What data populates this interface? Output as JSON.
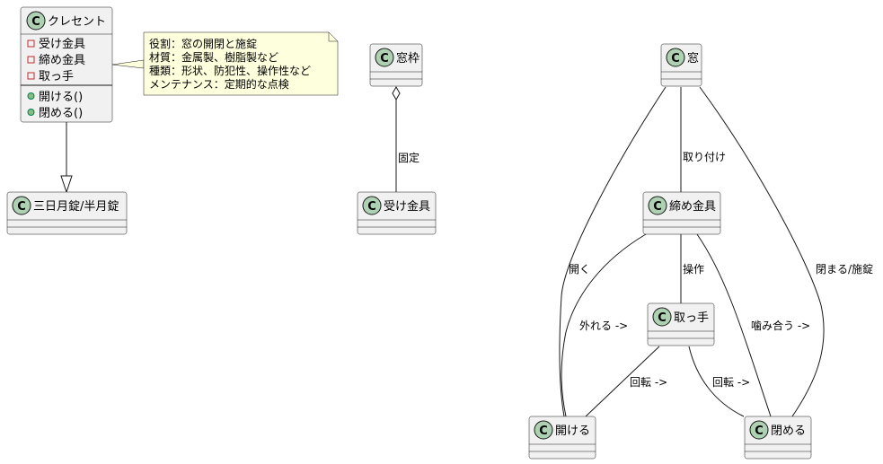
{
  "diagram": {
    "type": "uml-class-diagram",
    "colors": {
      "class_fill": "#f1f1f1",
      "class_border": "#181818",
      "stereotype_circle": "#add1b2",
      "note_fill": "#feffdd",
      "private_marker": "#c82930",
      "public_marker": "#84be84",
      "edge": "#181818"
    },
    "classes": [
      {
        "id": "crescent",
        "name": "クレセント",
        "attributes": [
          {
            "visibility": "private",
            "name": "受け金具"
          },
          {
            "visibility": "private",
            "name": "締め金具"
          },
          {
            "visibility": "private",
            "name": "取っ手"
          }
        ],
        "methods": [
          {
            "visibility": "public",
            "name": "開ける()"
          },
          {
            "visibility": "public",
            "name": "閉める()"
          }
        ]
      },
      {
        "id": "moon_lock",
        "name": "三日月錠/半月錠",
        "attributes": [],
        "methods": []
      },
      {
        "id": "window_frame",
        "name": "窓枠",
        "attributes": [],
        "methods": []
      },
      {
        "id": "receiver",
        "name": "受け金具",
        "attributes": [],
        "methods": []
      },
      {
        "id": "window",
        "name": "窓",
        "attributes": [],
        "methods": []
      },
      {
        "id": "fastener",
        "name": "締め金具",
        "attributes": [],
        "methods": []
      },
      {
        "id": "handle",
        "name": "取っ手",
        "attributes": [],
        "methods": []
      },
      {
        "id": "open",
        "name": "開ける",
        "attributes": [],
        "methods": []
      },
      {
        "id": "close",
        "name": "閉める",
        "attributes": [],
        "methods": []
      }
    ],
    "stereotype_letter": "C",
    "note": {
      "attached_to": "crescent",
      "lines": [
        "役割：窓の開閉と施錠",
        "材質：金属製、樹脂製など",
        "種類：形状、防犯性、操作性など",
        "メンテナンス：定期的な点検"
      ]
    },
    "relations": [
      {
        "from": "crescent",
        "to": "moon_lock",
        "type": "inheritance",
        "label": ""
      },
      {
        "from": "window_frame",
        "to": "receiver",
        "type": "aggregation",
        "label": "固定"
      },
      {
        "from": "window",
        "to": "fastener",
        "type": "association",
        "label": "取り付け"
      },
      {
        "from": "window",
        "to": "open",
        "type": "association",
        "label": "開く"
      },
      {
        "from": "window",
        "to": "close",
        "type": "association",
        "label": "閉まる/施錠"
      },
      {
        "from": "fastener",
        "to": "handle",
        "type": "association",
        "label": "操作"
      },
      {
        "from": "fastener",
        "to": "open",
        "type": "association",
        "label": "外れる ->"
      },
      {
        "from": "fastener",
        "to": "close",
        "type": "association",
        "label": "噛み合う ->"
      },
      {
        "from": "handle",
        "to": "open",
        "type": "association",
        "label": "回転 ->"
      },
      {
        "from": "handle",
        "to": "close",
        "type": "association",
        "label": "回転 ->"
      }
    ]
  }
}
